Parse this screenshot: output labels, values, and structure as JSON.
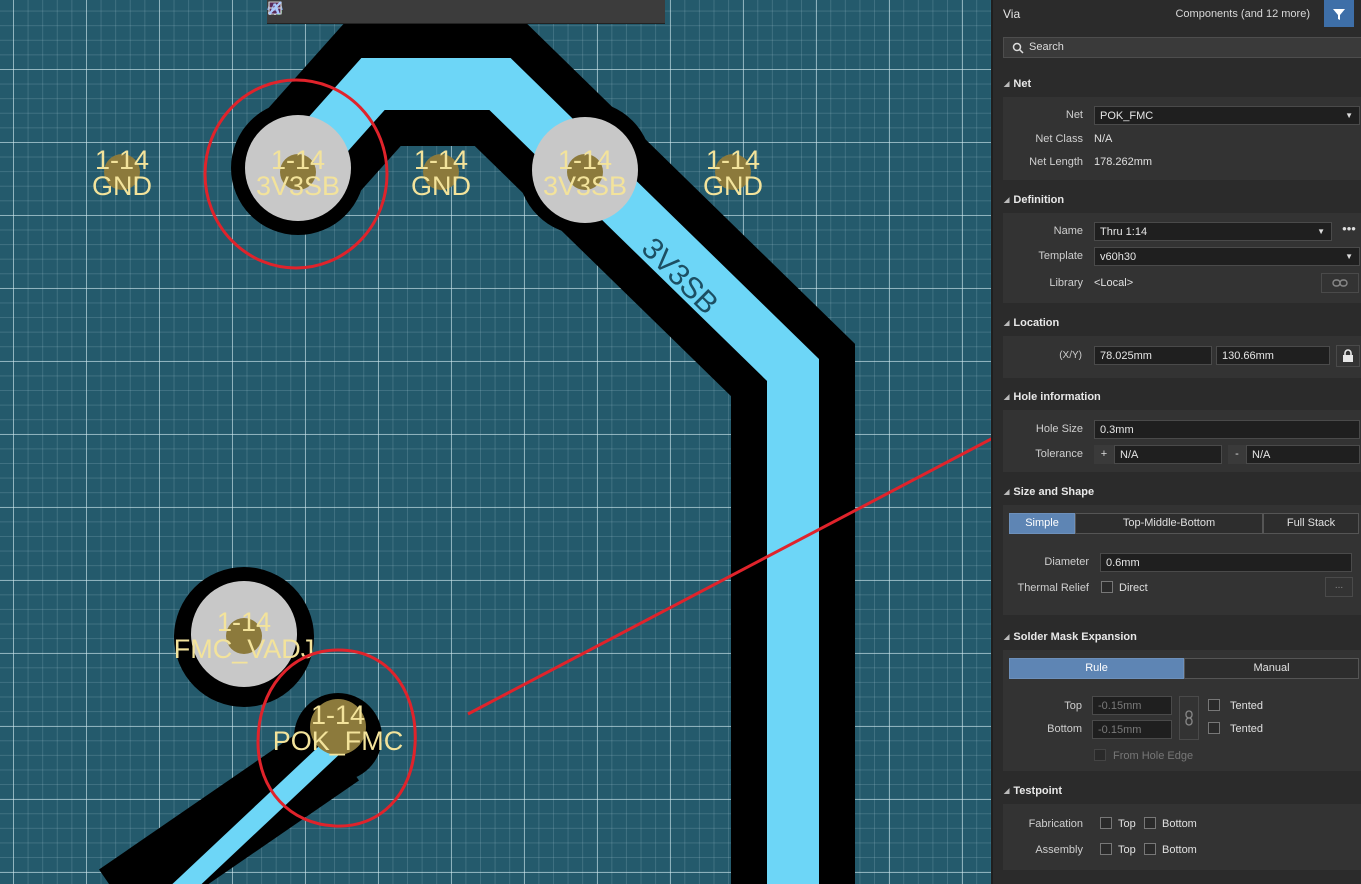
{
  "toolbar": {
    "icons": [
      "filter-icon",
      "route-icon",
      "cross-icon",
      "select-rect-icon",
      "chart-icon",
      "chip-icon",
      "interactive-route-icon",
      "tune-length-icon",
      "pin-icon",
      "polygon-icon",
      "highlight-icon",
      "dimension-icon",
      "text-icon",
      "line-icon"
    ]
  },
  "pcb": {
    "vias": [
      {
        "num": "1-14",
        "net": "GND"
      },
      {
        "num": "1-14",
        "net": "3V3SB"
      },
      {
        "num": "1-14",
        "net": "GND"
      },
      {
        "num": "1-14",
        "net": "3V3SB"
      },
      {
        "num": "1-14",
        "net": "GND"
      },
      {
        "num": "1-14",
        "net": "FMC_VADJ"
      },
      {
        "num": "1-14",
        "net": "POK_FMC"
      }
    ],
    "trace_label": "3V3SB",
    "colors": {
      "board": "#245a6c",
      "trace": "#6dd6f7",
      "clearance": "#000000",
      "via": "#8c7a3c",
      "pad": "#c8c8c8",
      "markup": "#e0232b",
      "label": "#f3e39b"
    }
  },
  "panel": {
    "object_type": "Via",
    "filter_text": "Components (and 12 more)",
    "search_placeholder": "Search",
    "net": {
      "title": "Net",
      "net_label": "Net",
      "net_value": "POK_FMC",
      "class_label": "Net Class",
      "class_value": "N/A",
      "length_label": "Net Length",
      "length_value": "178.262mm"
    },
    "definition": {
      "title": "Definition",
      "name_label": "Name",
      "name_value": "Thru 1:14",
      "template_label": "Template",
      "template_value": "v60h30",
      "library_label": "Library",
      "library_value": "<Local>"
    },
    "location": {
      "title": "Location",
      "xy_label": "(X/Y)",
      "x_value": "78.025mm",
      "y_value": "130.66mm"
    },
    "hole": {
      "title": "Hole information",
      "size_label": "Hole Size",
      "size_value": "0.3mm",
      "tol_label": "Tolerance",
      "plus": "+",
      "minus": "-",
      "tol_plus": "N/A",
      "tol_minus": "N/A"
    },
    "size_shape": {
      "title": "Size and Shape",
      "tabs": [
        "Simple",
        "Top-Middle-Bottom",
        "Full Stack"
      ],
      "diameter_label": "Diameter",
      "diameter_value": "0.6mm",
      "thermal_label": "Thermal Relief",
      "thermal_option": "Direct",
      "more": "..."
    },
    "solder_mask": {
      "title": "Solder Mask Expansion",
      "tabs": [
        "Rule",
        "Manual"
      ],
      "top_label": "Top",
      "top_value": "-0.15mm",
      "top_tented": "Tented",
      "bottom_label": "Bottom",
      "bottom_value": "-0.15mm",
      "bottom_tented": "Tented",
      "from_hole": "From Hole Edge"
    },
    "testpoint": {
      "title": "Testpoint",
      "fab_label": "Fabrication",
      "asm_label": "Assembly",
      "top": "Top",
      "bottom": "Bottom"
    }
  }
}
